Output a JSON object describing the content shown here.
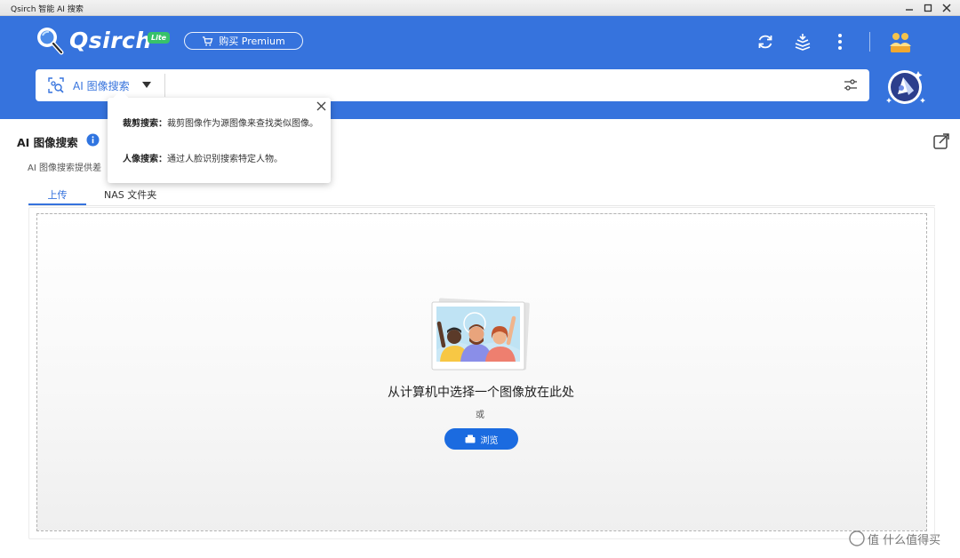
{
  "window": {
    "title": "Qsirch 智能 AI 搜索"
  },
  "header": {
    "brand": "Qsirch",
    "badge": "Lite",
    "premium_label": "购买 Premium"
  },
  "search": {
    "mode_label": "AI 图像搜索",
    "placeholder": "",
    "value": ""
  },
  "popover": {
    "crop_key": "裁剪搜索：",
    "crop_text": "裁剪图像作为源图像来查找类似图像。",
    "face_key": "人像搜索：",
    "face_text": "通过人脸识别搜索特定人物。"
  },
  "content": {
    "section_title": "AI 图像搜索",
    "description": "AI 图像搜索提供差",
    "tabs": [
      {
        "label": "上传",
        "active": true
      },
      {
        "label": "NAS 文件夹",
        "active": false
      }
    ],
    "drop_text": "从计算机中选择一个图像放在此处",
    "or_text": "或",
    "browse_label": "浏览"
  },
  "watermark": "值 什么值得买",
  "colors": {
    "brand": "#3673dd",
    "button": "#1b6be0",
    "badge": "#37c26b"
  },
  "icons": [
    "qsirch-logo-icon",
    "cart-icon",
    "refresh-icon",
    "tasks-icon",
    "more-icon",
    "users-icon",
    "image-search-icon",
    "chevron-down-icon",
    "filter-icon",
    "assistant-icon",
    "info-icon",
    "popout-icon",
    "close-icon",
    "photo-illustration",
    "upload-icon"
  ]
}
